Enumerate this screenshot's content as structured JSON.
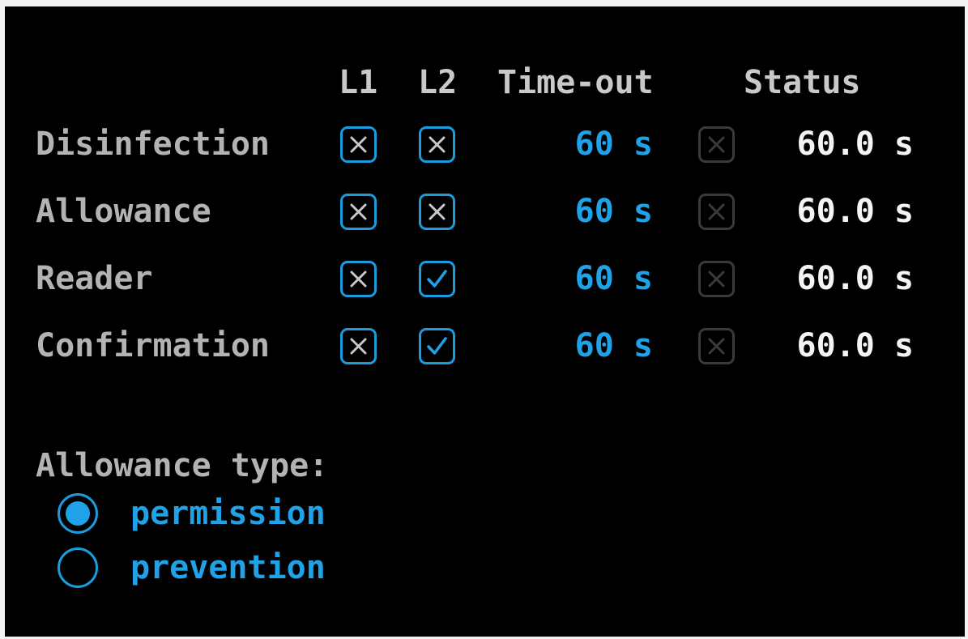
{
  "headers": {
    "l1": "L1",
    "l2": "L2",
    "timeout": "Time-out",
    "status": "Status"
  },
  "rows": [
    {
      "label": "Disinfection",
      "l1": "crossed",
      "l2": "crossed",
      "timeout": "60 s",
      "status_check": "crossed",
      "status": "60.0 s"
    },
    {
      "label": "Allowance",
      "l1": "crossed",
      "l2": "crossed",
      "timeout": "60 s",
      "status_check": "crossed",
      "status": "60.0 s"
    },
    {
      "label": "Reader",
      "l1": "crossed",
      "l2": "checked",
      "timeout": "60 s",
      "status_check": "crossed",
      "status": "60.0 s"
    },
    {
      "label": "Confirmation",
      "l1": "crossed",
      "l2": "checked",
      "timeout": "60 s",
      "status_check": "crossed",
      "status": "60.0 s"
    }
  ],
  "allowance_type": {
    "title": "Allowance type:",
    "options": [
      {
        "label": "permission",
        "selected": true
      },
      {
        "label": "prevention",
        "selected": false
      }
    ]
  },
  "colors": {
    "accent": "#1fa2e8",
    "background": "#000000",
    "label": "#b3b3b3",
    "value": "#f4f4f4",
    "disabled": "#3a3a3a"
  },
  "icons": {
    "crossed": "x-mark-icon",
    "checked": "check-mark-icon"
  }
}
